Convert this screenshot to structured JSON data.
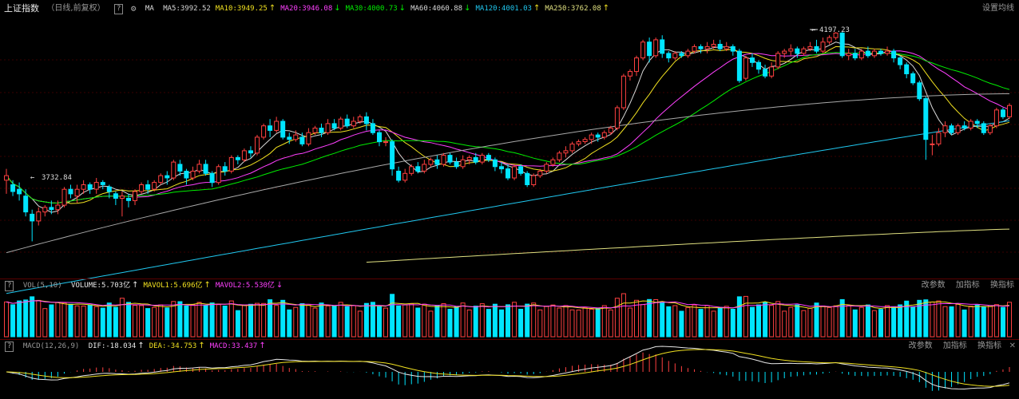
{
  "colors": {
    "background": "#000000",
    "up": "#ff4040",
    "down": "#00e5ff",
    "ma5": "#d8d8d8",
    "ma10": "#f0e020",
    "ma20": "#ff40ff",
    "ma30": "#00ee00",
    "ma60": "#a8a8a8",
    "ma120": "#20c8f0",
    "ma250": "#e0e080",
    "grid": "#3a0000"
  },
  "header": {
    "title": "上证指数",
    "subtitle": "（日线,前复权）",
    "help": "?",
    "ma_label": "MA",
    "indicators": [
      {
        "text": "MA5:3992.52",
        "arrow": "",
        "color": "#d8d8d8"
      },
      {
        "text": "MA10:3949.25",
        "arrow": "↑",
        "color": "#f0e020"
      },
      {
        "text": "MA20:3946.08",
        "arrow": "↓",
        "color": "#ff40ff"
      },
      {
        "text": "MA30:4000.73",
        "arrow": "↓",
        "color": "#00ee00"
      },
      {
        "text": "MA60:4060.88",
        "arrow": "↓",
        "color": "#d8d8d8"
      },
      {
        "text": "MA120:4001.03",
        "arrow": "↑",
        "color": "#20c8f0"
      },
      {
        "text": "MA250:3762.08",
        "arrow": "↑",
        "color": "#e0e080"
      }
    ],
    "settings": "设置均线"
  },
  "annotations": {
    "high": "4197.23",
    "low": "3732.84"
  },
  "vol": {
    "name": "VOL(5,10)",
    "indicators": [
      {
        "text": "VOLUME:5.703亿",
        "arrow": "↑",
        "color": "#e8e8e8"
      },
      {
        "text": "MAVOL1:5.696亿",
        "arrow": "↑",
        "color": "#f0e020"
      },
      {
        "text": "MAVOL2:5.530亿",
        "arrow": "↓",
        "color": "#ff40ff"
      }
    ],
    "links": [
      "改参数",
      "加指标",
      "换指标"
    ]
  },
  "macd": {
    "name": "MACD(12,26,9)",
    "indicators": [
      {
        "text": "DIF:-18.034",
        "arrow": "↑",
        "color": "#e8e8e8"
      },
      {
        "text": "DEA:-34.753",
        "arrow": "↑",
        "color": "#f0e020"
      },
      {
        "text": "MACD:33.437",
        "arrow": "↑",
        "color": "#ff40ff"
      }
    ],
    "links": [
      "改参数",
      "加指标",
      "换指标"
    ],
    "close": "✕"
  },
  "chart_data": {
    "type": "candlestick",
    "candles": [
      [
        3870,
        3880,
        3840,
        3895
      ],
      [
        3860,
        3845,
        3835,
        3870
      ],
      [
        3850,
        3840,
        3825,
        3865
      ],
      [
        3835,
        3800,
        3790,
        3850
      ],
      [
        3795,
        3780,
        3735,
        3805
      ],
      [
        3780,
        3800,
        3770,
        3810
      ],
      [
        3800,
        3810,
        3790,
        3815
      ],
      [
        3810,
        3805,
        3795,
        3825
      ],
      [
        3805,
        3815,
        3795,
        3825
      ],
      [
        3815,
        3850,
        3810,
        3855
      ],
      [
        3850,
        3840,
        3830,
        3860
      ],
      [
        3835,
        3850,
        3820,
        3860
      ],
      [
        3850,
        3860,
        3840,
        3870
      ],
      [
        3860,
        3850,
        3840,
        3865
      ],
      [
        3850,
        3865,
        3840,
        3875
      ],
      [
        3865,
        3860,
        3850,
        3870
      ],
      [
        3855,
        3845,
        3830,
        3860
      ],
      [
        3840,
        3830,
        3815,
        3845
      ],
      [
        3830,
        3835,
        3790,
        3845
      ],
      [
        3830,
        3825,
        3810,
        3840
      ],
      [
        3825,
        3845,
        3815,
        3850
      ],
      [
        3845,
        3860,
        3840,
        3865
      ],
      [
        3860,
        3850,
        3840,
        3870
      ],
      [
        3850,
        3865,
        3845,
        3870
      ],
      [
        3865,
        3880,
        3860,
        3885
      ],
      [
        3880,
        3875,
        3860,
        3890
      ],
      [
        3875,
        3910,
        3870,
        3915
      ],
      [
        3905,
        3890,
        3880,
        3915
      ],
      [
        3890,
        3875,
        3860,
        3895
      ],
      [
        3875,
        3890,
        3870,
        3900
      ],
      [
        3890,
        3905,
        3885,
        3915
      ],
      [
        3905,
        3885,
        3880,
        3915
      ],
      [
        3885,
        3865,
        3855,
        3890
      ],
      [
        3865,
        3900,
        3860,
        3905
      ],
      [
        3900,
        3890,
        3880,
        3910
      ],
      [
        3890,
        3920,
        3885,
        3925
      ],
      [
        3920,
        3915,
        3905,
        3925
      ],
      [
        3915,
        3935,
        3910,
        3940
      ],
      [
        3935,
        3930,
        3920,
        3945
      ],
      [
        3930,
        3965,
        3925,
        3970
      ],
      [
        3965,
        3990,
        3960,
        3995
      ],
      [
        3990,
        3980,
        3965,
        4005
      ],
      [
        3980,
        4000,
        3975,
        4010
      ],
      [
        4000,
        3965,
        3960,
        4005
      ],
      [
        3965,
        3960,
        3950,
        3975
      ],
      [
        3960,
        3970,
        3955,
        3980
      ],
      [
        3965,
        3950,
        3945,
        3975
      ],
      [
        3950,
        3975,
        3945,
        3985
      ],
      [
        3975,
        3985,
        3970,
        3990
      ],
      [
        3985,
        3975,
        3965,
        3995
      ],
      [
        3975,
        3995,
        3970,
        4005
      ],
      [
        3995,
        3985,
        3980,
        4005
      ],
      [
        3985,
        4005,
        3980,
        4010
      ],
      [
        4005,
        3990,
        3985,
        4015
      ],
      [
        3990,
        4000,
        3985,
        4010
      ],
      [
        4000,
        4010,
        3995,
        4015
      ],
      [
        4010,
        3995,
        3980,
        4020
      ],
      [
        3995,
        3975,
        3970,
        4005
      ],
      [
        3975,
        3955,
        3945,
        3980
      ],
      [
        3955,
        3955,
        3945,
        3965
      ],
      [
        3955,
        3895,
        3880,
        3960
      ],
      [
        3890,
        3870,
        3865,
        3900
      ],
      [
        3870,
        3885,
        3865,
        3895
      ],
      [
        3885,
        3900,
        3880,
        3905
      ],
      [
        3900,
        3890,
        3885,
        3910
      ],
      [
        3890,
        3905,
        3885,
        3915
      ],
      [
        3905,
        3915,
        3900,
        3920
      ],
      [
        3915,
        3905,
        3895,
        3925
      ],
      [
        3905,
        3925,
        3900,
        3930
      ],
      [
        3925,
        3910,
        3905,
        3930
      ],
      [
        3910,
        3900,
        3895,
        3920
      ],
      [
        3900,
        3915,
        3895,
        3925
      ],
      [
        3915,
        3920,
        3905,
        3925
      ],
      [
        3920,
        3910,
        3905,
        3930
      ],
      [
        3910,
        3925,
        3905,
        3930
      ],
      [
        3925,
        3915,
        3910,
        3930
      ],
      [
        3915,
        3900,
        3890,
        3920
      ],
      [
        3900,
        3895,
        3885,
        3910
      ],
      [
        3895,
        3875,
        3870,
        3905
      ],
      [
        3875,
        3900,
        3870,
        3905
      ],
      [
        3900,
        3885,
        3880,
        3905
      ],
      [
        3885,
        3860,
        3855,
        3890
      ],
      [
        3860,
        3880,
        3855,
        3885
      ],
      [
        3880,
        3890,
        3875,
        3895
      ],
      [
        3890,
        3905,
        3885,
        3910
      ],
      [
        3905,
        3915,
        3900,
        3920
      ],
      [
        3915,
        3930,
        3910,
        3935
      ],
      [
        3930,
        3935,
        3920,
        3945
      ],
      [
        3935,
        3950,
        3930,
        3955
      ],
      [
        3950,
        3955,
        3945,
        3960
      ],
      [
        3955,
        3960,
        3950,
        3965
      ],
      [
        3960,
        3970,
        3950,
        3975
      ],
      [
        3970,
        3965,
        3955,
        3975
      ],
      [
        3965,
        3975,
        3960,
        3980
      ],
      [
        3975,
        3985,
        3970,
        3990
      ],
      [
        3985,
        4030,
        3980,
        4035
      ],
      [
        4030,
        4100,
        4025,
        4105
      ],
      [
        4100,
        4110,
        4090,
        4115
      ],
      [
        4110,
        4140,
        4100,
        4145
      ],
      [
        4140,
        4175,
        4135,
        4180
      ],
      [
        4175,
        4145,
        4130,
        4185
      ],
      [
        4145,
        4180,
        4140,
        4185
      ],
      [
        4180,
        4150,
        4140,
        4190
      ],
      [
        4150,
        4140,
        4130,
        4155
      ],
      [
        4140,
        4150,
        4135,
        4155
      ],
      [
        4150,
        4145,
        4140,
        4155
      ],
      [
        4145,
        4155,
        4140,
        4160
      ],
      [
        4155,
        4165,
        4150,
        4170
      ],
      [
        4165,
        4160,
        4150,
        4170
      ],
      [
        4160,
        4165,
        4150,
        4175
      ],
      [
        4165,
        4170,
        4160,
        4180
      ],
      [
        4170,
        4160,
        4155,
        4180
      ],
      [
        4160,
        4165,
        4155,
        4175
      ],
      [
        4165,
        4155,
        4145,
        4170
      ],
      [
        4155,
        4090,
        4085,
        4160
      ],
      [
        4095,
        4140,
        4090,
        4145
      ],
      [
        4140,
        4130,
        4120,
        4150
      ],
      [
        4130,
        4115,
        4105,
        4135
      ],
      [
        4115,
        4100,
        4095,
        4125
      ],
      [
        4100,
        4120,
        4095,
        4130
      ],
      [
        4120,
        4150,
        4115,
        4155
      ],
      [
        4150,
        4155,
        4140,
        4160
      ],
      [
        4155,
        4160,
        4145,
        4170
      ],
      [
        4160,
        4150,
        4140,
        4165
      ],
      [
        4150,
        4160,
        4145,
        4165
      ],
      [
        4160,
        4165,
        4155,
        4175
      ],
      [
        4165,
        4155,
        4150,
        4180
      ],
      [
        4155,
        4175,
        4150,
        4185
      ],
      [
        4175,
        4185,
        4170,
        4190
      ],
      [
        4185,
        4195,
        4180,
        4197
      ],
      [
        4195,
        4145,
        4140,
        4197
      ],
      [
        4145,
        4150,
        4135,
        4160
      ],
      [
        4150,
        4140,
        4135,
        4160
      ],
      [
        4140,
        4155,
        4135,
        4160
      ],
      [
        4155,
        4145,
        4140,
        4165
      ],
      [
        4145,
        4155,
        4140,
        4160
      ],
      [
        4155,
        4150,
        4145,
        4160
      ],
      [
        4150,
        4155,
        4145,
        4165
      ],
      [
        4155,
        4140,
        4130,
        4160
      ],
      [
        4140,
        4125,
        4115,
        4145
      ],
      [
        4125,
        4105,
        4095,
        4130
      ],
      [
        4105,
        4085,
        4080,
        4110
      ],
      [
        4085,
        4050,
        4045,
        4090
      ],
      [
        4050,
        3960,
        3915,
        4055
      ],
      [
        3950,
        3950,
        3925,
        3970
      ],
      [
        3950,
        3975,
        3945,
        3985
      ],
      [
        3975,
        3990,
        3965,
        4000
      ],
      [
        3990,
        3975,
        3970,
        3995
      ],
      [
        3975,
        3990,
        3970,
        3995
      ],
      [
        3990,
        3985,
        3980,
        4000
      ],
      [
        3985,
        4000,
        3980,
        4005
      ],
      [
        4000,
        3995,
        3985,
        4005
      ],
      [
        3995,
        3975,
        3970,
        4000
      ],
      [
        3975,
        3990,
        3970,
        3995
      ],
      [
        3990,
        4025,
        3985,
        4030
      ],
      [
        4025,
        4010,
        4005,
        4030
      ],
      [
        4010,
        4035,
        4005,
        4040
      ]
    ],
    "ma_levels": {
      "ma60": 4060.88,
      "ma120": 4001.03,
      "ma250": 3762.08
    },
    "macd_values": {
      "DIF": -18.034,
      "DEA": -34.753,
      "MACD": 33.437
    }
  }
}
